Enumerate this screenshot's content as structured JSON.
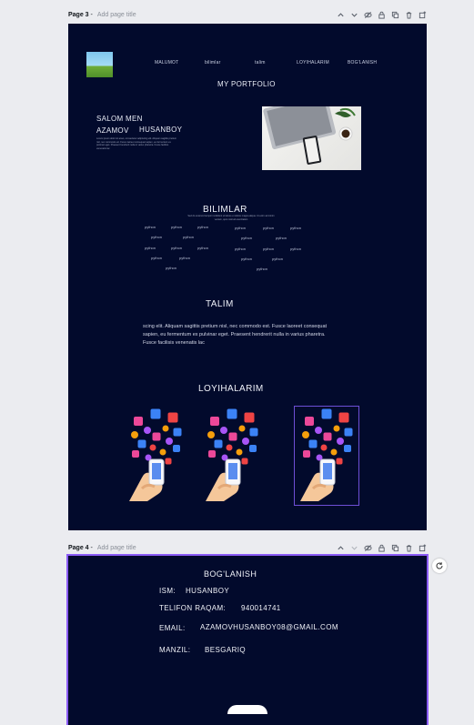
{
  "page3": {
    "bar": {
      "page_label": "Page 3",
      "sep": " - ",
      "add_title": "Add page title"
    },
    "nav": [
      "MALUMOT",
      "bilimlar",
      "talim",
      "LOYIHALARIM",
      "BOG'LANISH"
    ],
    "header": "MY PORTFOLIO",
    "hero": {
      "greeting": "SALOM MEN",
      "first": "AZAMOV",
      "last": "HUSANBOY",
      "blurb": "Lorem ipsum dolor sit amet, consectetur adipiscing elit. Aliquam sagittis pretium nisl, nec commodo est. Fusce laoreet consequat sapien, eu fermentum ex pulvinar eget. Praesent hendrerit nulla in varius pharetra. Fusce facilisis venenatis lac"
    },
    "bilimlar": {
      "title": "BILIMLAR",
      "caption": "Sed do eiusmod tempor incididunt ut labore et dolore magna aliqua. Ut enim ad minim veniam, quis nostrud exercitation",
      "item": "python"
    },
    "talim": {
      "title": "TALIM",
      "text": "scing elit. Aliquam sagittis pretium nisl, nec commodo est. Fusce laoreet consequat sapien, eu fermentum ex pulvinar eget. Praesent hendrerit nulla in varius pharetra. Fusce facilisis venenatis lac"
    },
    "loyihalarim": {
      "title": "LOYIHALARIM"
    }
  },
  "page4": {
    "bar": {
      "page_label": "Page 4",
      "sep": " - ",
      "add_title": "Add page title"
    },
    "title": "BOG'LANISH",
    "fields": [
      {
        "label": "ISM:",
        "value": "HUSANBOY"
      },
      {
        "label": "TELIFON RAQAM:",
        "value": "940014741"
      },
      {
        "label": "EMAIL:",
        "value": "AZAMOVHUSANBOY08@GMAIL.COM"
      },
      {
        "label": "MANZIL:",
        "value": "BESGARIQ"
      }
    ]
  },
  "toolbar_icons": [
    "chevron-up-icon",
    "chevron-down-icon",
    "eye-off-icon",
    "lock-icon",
    "duplicate-icon",
    "trash-icon",
    "add-page-icon"
  ],
  "colors": {
    "page_bg": "#020a2c",
    "canvas_bg": "#ebecf0",
    "selection": "#8b5cf6"
  }
}
